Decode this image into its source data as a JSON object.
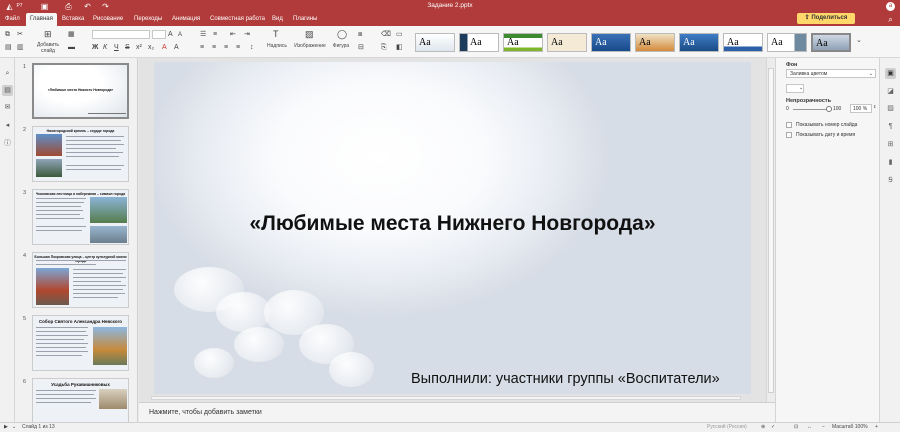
{
  "app": {
    "logo_text": "P7"
  },
  "titlebar": {
    "document": "Задание 2.pptx"
  },
  "menu": {
    "items": [
      {
        "label": "Файл"
      },
      {
        "label": "Главная"
      },
      {
        "label": "Вставка"
      },
      {
        "label": "Рисование"
      },
      {
        "label": "Переходы"
      },
      {
        "label": "Анимация"
      },
      {
        "label": "Совместная работа"
      },
      {
        "label": "Вид"
      },
      {
        "label": "Плагины"
      }
    ],
    "active_index": 1,
    "share_label": "Поделиться"
  },
  "ribbon": {
    "add_slide": "Добавить слайд",
    "caption": "Надпись",
    "image": "Изображение",
    "shape": "Фигура",
    "theme_sample": "Aa"
  },
  "thumbnails": [
    {
      "num": "1",
      "title": "«Любимые места Нижнего Новгорода»"
    },
    {
      "num": "2",
      "title": "Нижегородский кремль – сердце города"
    },
    {
      "num": "3",
      "title": "Чкаловская лестница и набережная – символ города"
    },
    {
      "num": "4",
      "title": "Большая Покровская улица – центр культурной жизни города"
    },
    {
      "num": "5",
      "title": "Собор Святого Александра Невского"
    },
    {
      "num": "6",
      "title": "Усадьба Рукавишниковых"
    }
  ],
  "slide": {
    "title": "«Любимые места Нижнего Новгорода»",
    "subtitle": "Выполнили: участники группы «Воспитатели»"
  },
  "notes": {
    "placeholder": "Нажмите, чтобы добавить заметки"
  },
  "panel": {
    "fill_label": "Фон",
    "fill_value": "Заливка цветом",
    "opacity_label": "Непрозрачность",
    "opacity_min": "0",
    "opacity_max": "100",
    "opacity_value": "100 %",
    "show_number": "Показывать номер слайда",
    "show_date": "Показывать дату и время"
  },
  "status": {
    "slide_info": "Слайд 1 из 13",
    "language": "Русский (Россия)",
    "zoom": "Масштаб 100%"
  },
  "colors": {
    "brand": "#b03b3a",
    "share": "#ffd76a"
  }
}
